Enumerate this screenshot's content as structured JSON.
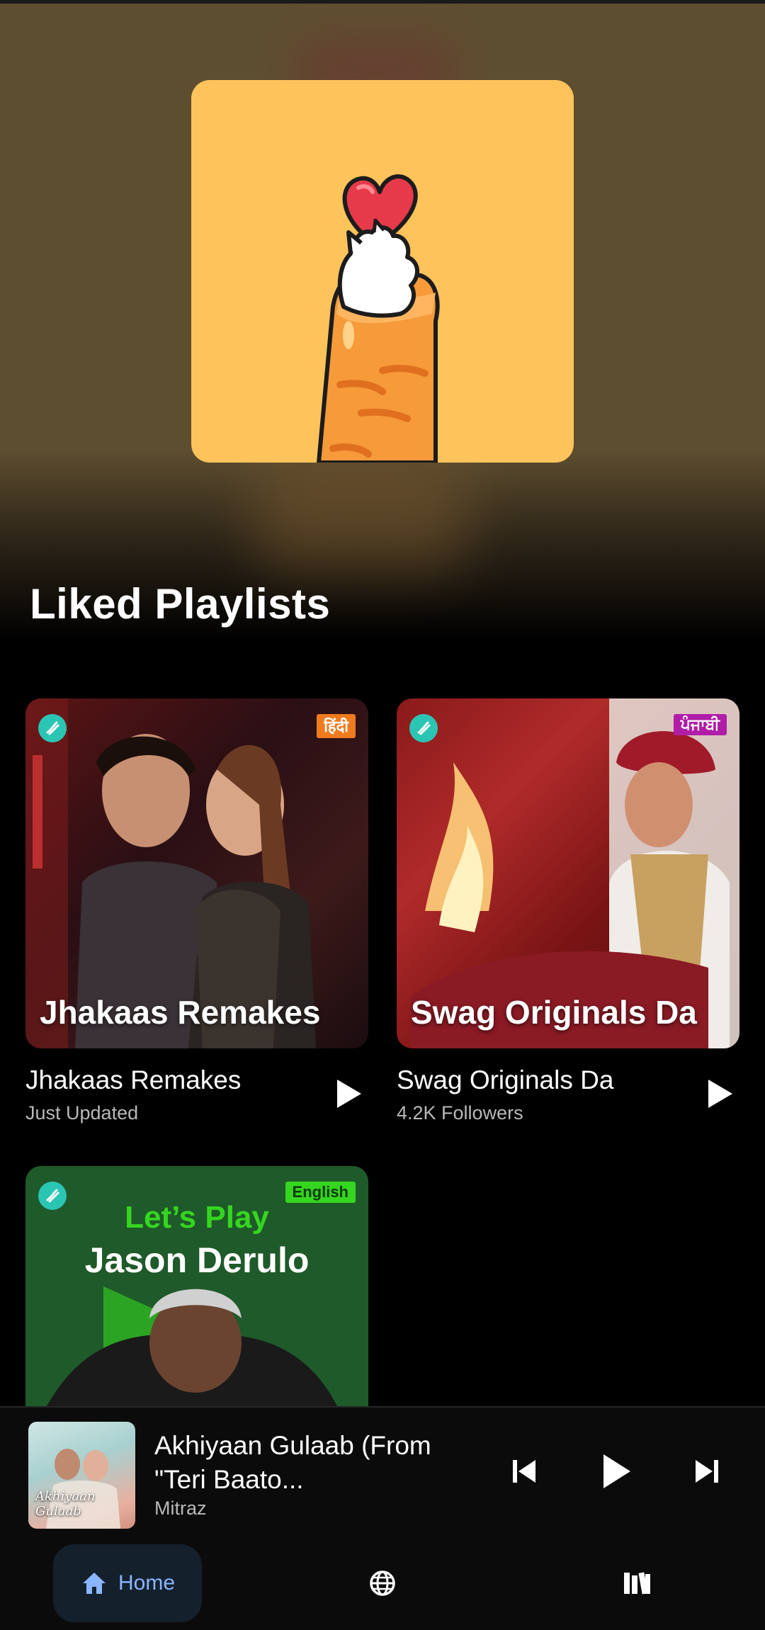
{
  "section": {
    "title": "Liked Playlists"
  },
  "playlists": [
    {
      "cover_title": "Jhakaas Remakes",
      "badge": "हिंदी",
      "badge_color": "#f07a1e",
      "title": "Jhakaas Remakes",
      "subtitle": "Just Updated"
    },
    {
      "cover_title": "Swag Originals Da",
      "badge": "ਪੰਜਾਬੀ",
      "badge_color": "#b01ea7",
      "title": "Swag Originals Da",
      "subtitle": "4.2K Followers"
    },
    {
      "cover_line1": "Let’s Play",
      "cover_line2": "Jason Derulo",
      "badge": "English",
      "badge_color": "#35d61f"
    }
  ],
  "now_playing": {
    "title": "Akhiyaan Gulaab (From \"Teri Baato...",
    "artist": "Mitraz",
    "art_text": "Akhiyaan Gulaab"
  },
  "nav": {
    "home_label": "Home"
  },
  "colors": {
    "accent": "#8ab6ff",
    "hero_bg": "#5e4e30",
    "art_bg": "#ffc35c"
  }
}
